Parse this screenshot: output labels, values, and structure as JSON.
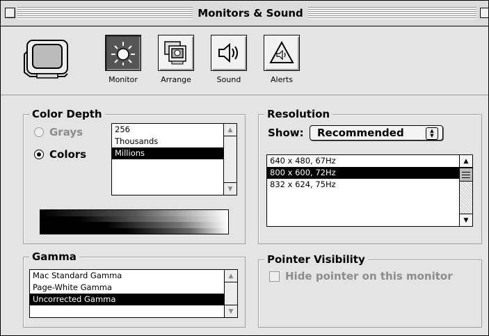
{
  "window": {
    "title": "Monitors & Sound"
  },
  "toolbar": {
    "tools": [
      {
        "label": "Monitor",
        "icon": "monitor-brightness-icon",
        "selected": true
      },
      {
        "label": "Arrange",
        "icon": "arrange-monitors-icon",
        "selected": false
      },
      {
        "label": "Sound",
        "icon": "speaker-icon",
        "selected": false
      },
      {
        "label": "Alerts",
        "icon": "alert-triangle-icon",
        "selected": false
      }
    ]
  },
  "color_depth": {
    "title": "Color Depth",
    "radios": [
      {
        "label": "Grays",
        "selected": false,
        "enabled": false
      },
      {
        "label": "Colors",
        "selected": true,
        "enabled": true
      }
    ],
    "list": {
      "items": [
        "256",
        "Thousands",
        "Millions"
      ],
      "selected": "Millions"
    }
  },
  "resolution": {
    "title": "Resolution",
    "show_label": "Show:",
    "show_value": "Recommended",
    "list": {
      "items": [
        "640 x 480, 67Hz",
        "800 x 600, 72Hz",
        "832 x 624, 75Hz"
      ],
      "selected": "800 x 600, 72Hz"
    }
  },
  "gamma": {
    "title": "Gamma",
    "list": {
      "items": [
        "Mac Standard Gamma",
        "Page-White Gamma",
        "Uncorrected Gamma"
      ],
      "selected": "Uncorrected Gamma"
    }
  },
  "pointer_visibility": {
    "title": "Pointer Visibility",
    "checkbox_label": "Hide pointer on this monitor",
    "checked": false,
    "enabled": false
  }
}
